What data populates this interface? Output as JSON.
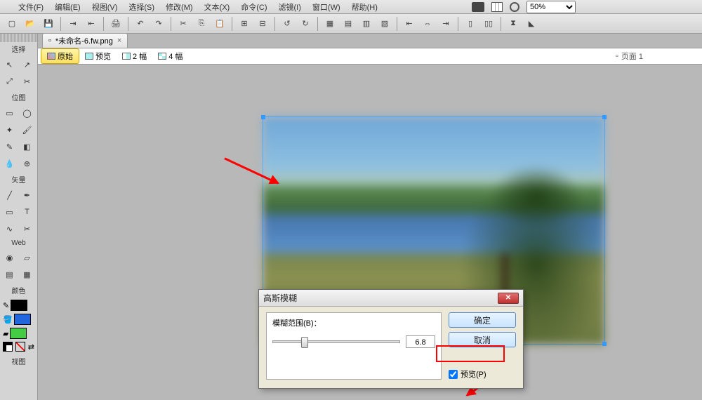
{
  "menu": {
    "items": [
      "文件(F)",
      "编辑(E)",
      "视图(V)",
      "选择(S)",
      "修改(M)",
      "文本(X)",
      "命令(C)",
      "滤镜(I)",
      "窗口(W)",
      "帮助(H)"
    ]
  },
  "zoom": {
    "value": "50%"
  },
  "leftPanel": {
    "groups": {
      "select": "选择",
      "bitmap": "位图",
      "vector": "矢量",
      "web": "Web",
      "color": "颜色",
      "view": "视图"
    }
  },
  "document": {
    "tab": "*未命名-6.fw.png",
    "viewModes": {
      "original": "原始",
      "preview": "预览",
      "two": "2 幅",
      "four": "4 幅"
    },
    "pageLabel": "页面 1"
  },
  "dialog": {
    "title": "高斯模糊",
    "rangeLabel": "模糊范围(B)：",
    "value": "6.8",
    "ok": "确定",
    "cancel": "取消",
    "previewLabel": "预览(P)"
  },
  "swatches": {
    "stroke": "#000000",
    "fill1": "#2266dd",
    "fill2": "#44cc44"
  }
}
